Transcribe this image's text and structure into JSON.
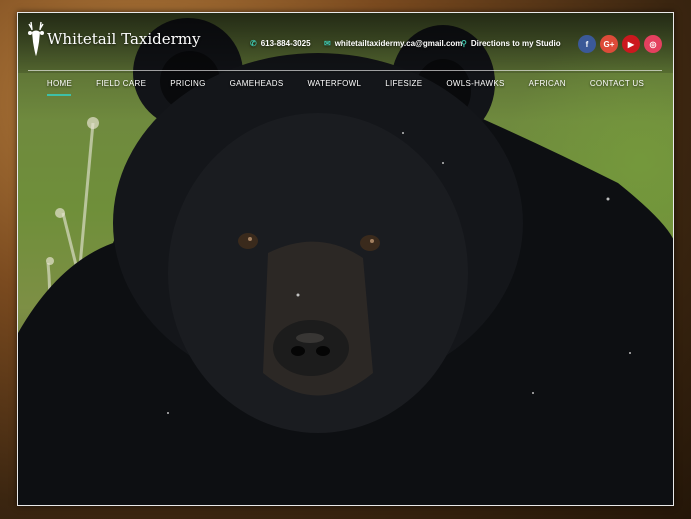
{
  "site": {
    "title": "Whitetail Taxidermy"
  },
  "contact": {
    "phone": "613-884-3025",
    "email": "whitetailtaxidermy.ca@gmail.com",
    "directions": "Directions to my Studio"
  },
  "social": [
    {
      "label": "f",
      "name": "facebook-icon",
      "color": "#3b5998"
    },
    {
      "label": "G+",
      "name": "google-plus-icon",
      "color": "#dd4b39"
    },
    {
      "label": "▶",
      "name": "youtube-icon",
      "color": "#cc181e"
    },
    {
      "label": "◎",
      "name": "instagram-icon",
      "color": "#e4405f"
    }
  ],
  "nav": {
    "items": [
      {
        "label": "HOME",
        "active": true
      },
      {
        "label": "FIELD CARE"
      },
      {
        "label": "PRICING"
      },
      {
        "label": "GAMEHEADS"
      },
      {
        "label": "WATERFOWL"
      },
      {
        "label": "LIFESIZE"
      },
      {
        "label": "OWLS-HAWKS"
      },
      {
        "label": "AFRICAN"
      },
      {
        "label": "CONTACT US"
      }
    ]
  },
  "colors": {
    "accent": "#3ec0a8"
  }
}
